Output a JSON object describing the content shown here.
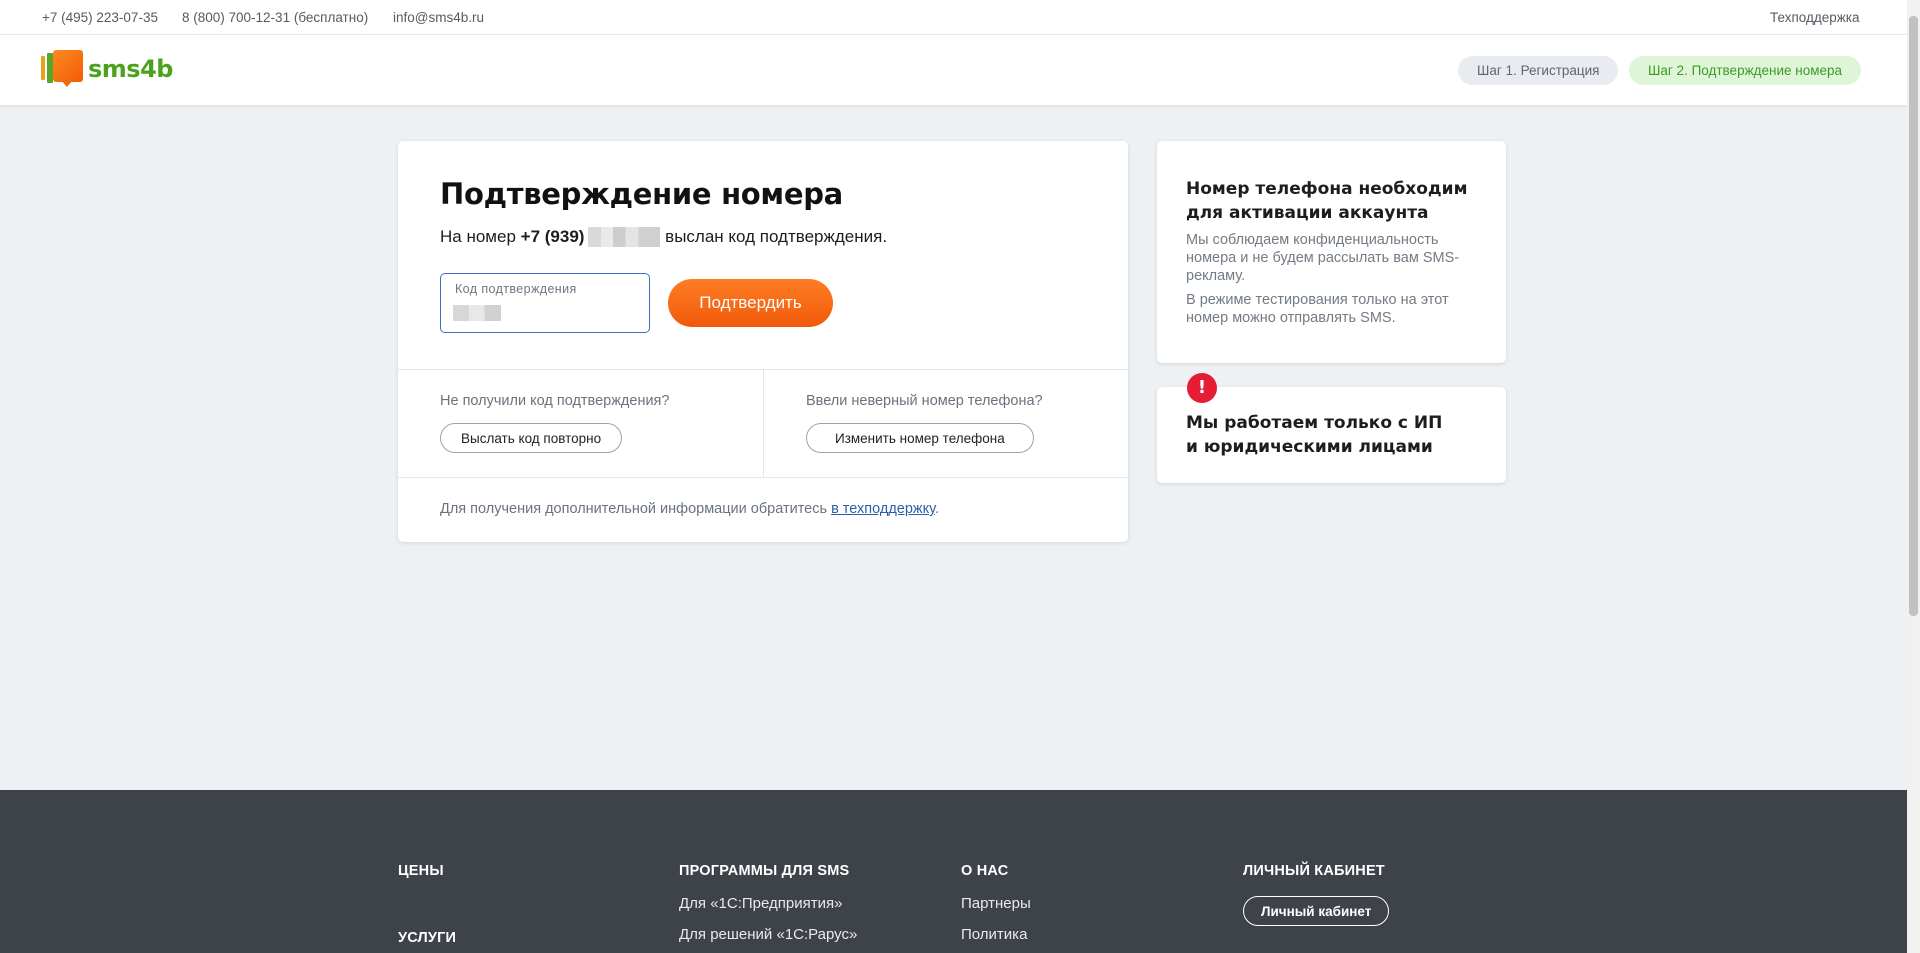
{
  "topbar": {
    "phone1": "+7 (495) 223-07-35",
    "phone2": "8 (800) 700-12-31 (бесплатно)",
    "email": "info@sms4b.ru",
    "support": "Техподдержка"
  },
  "header": {
    "logo_text": "sms4b",
    "steps": [
      {
        "label": "Шаг 1. Регистрация",
        "state": "done"
      },
      {
        "label": "Шаг 2. Подтверждение номера",
        "state": "active"
      }
    ]
  },
  "main": {
    "title": "Подтверждение номера",
    "sent_prefix": "На номер",
    "phone_prefix": "+7 (939)",
    "sent_suffix": "выслан код подтверждения.",
    "code_label": "Код подтверждения",
    "confirm_button": "Подтвердить",
    "no_code_question": "Не получили код подтверждения?",
    "resend_button": "Выслать код повторно",
    "wrong_number_question": "Ввели неверный номер телефона?",
    "change_number_button": "Изменить номер телефона",
    "info_text": "Для получения дополнительной информации обратитесь",
    "info_link": "в техподдержку",
    "info_end": "."
  },
  "side": {
    "card1_title_line1": "Номер телефона необходим",
    "card1_title_line2": "для активации аккаунта",
    "card1_text1": "Мы соблюдаем конфиденциальность номера и не будем рассылать вам SMS-рекламу.",
    "card1_text2": "В режиме тестирования только на этот номер можно отправлять SMS.",
    "alert_icon": "!",
    "card2_title_line1": "Мы работаем только с ИП",
    "card2_title_line2": "и юридическими лицами"
  },
  "footer": {
    "col1": [
      "ЦЕНЫ",
      "УСЛУГИ"
    ],
    "col2_title": "ПРОГРАММЫ ДЛЯ SMS",
    "col2_links": [
      "Для «1С:Предприятия»",
      "Для решений «1С:Рарус»"
    ],
    "col3_title": "О НАС",
    "col3_links": [
      "Партнеры",
      "Политика"
    ],
    "col4_title": "ЛИЧНЫЙ КАБИНЕТ",
    "col4_button": "Личный кабинет"
  },
  "colors": {
    "accent_orange": "#f05a0a",
    "brand_green": "#4aa31a",
    "alert_red": "#e41d35",
    "footer_bg": "#3e4249"
  }
}
